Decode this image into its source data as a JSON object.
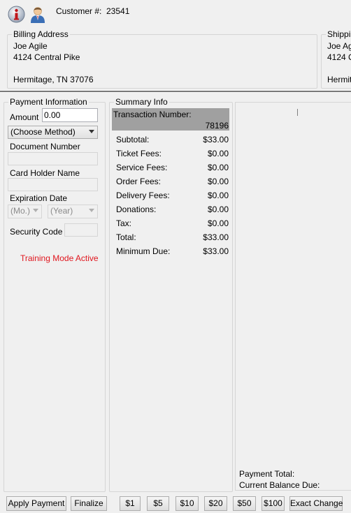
{
  "header": {
    "customer_label": "Customer #:",
    "customer_number": "23541"
  },
  "billing": {
    "legend": "Billing Address",
    "name": "Joe Agile",
    "street": "4124 Central Pike",
    "city_state_zip": "Hermitage, TN 37076"
  },
  "shipping": {
    "legend": "Shippin",
    "name": "Joe Ag",
    "street": "4124 C",
    "city_state_zip": "Hermit"
  },
  "payment": {
    "legend": "Payment Information",
    "amount_label": "Amount",
    "amount_value": "0.00",
    "method_value": "(Choose Method)",
    "document_number_label": "Document Number",
    "card_holder_label": "Card Holder Name",
    "expiration_label": "Expiration Date",
    "month_value": "(Mo.)",
    "year_value": "(Year)",
    "security_code_label": "Security Code",
    "training_mode_text": "Training Mode Active",
    "training_mode_color": "#e0161e"
  },
  "summary": {
    "legend": "Summary Info",
    "transaction_label": "Transaction Number:",
    "transaction_number": "78196",
    "rows": [
      {
        "label": "Subtotal:",
        "value": "$33.00"
      },
      {
        "label": "Ticket Fees:",
        "value": "$0.00"
      },
      {
        "label": "Service Fees:",
        "value": "$0.00"
      },
      {
        "label": "Order Fees:",
        "value": "$0.00"
      },
      {
        "label": "Delivery Fees:",
        "value": "$0.00"
      },
      {
        "label": "Donations:",
        "value": "$0.00"
      },
      {
        "label": "Tax:",
        "value": "$0.00"
      },
      {
        "label": "Total:",
        "value": "$33.00"
      },
      {
        "label": "Minimum Due:",
        "value": "$33.00"
      }
    ]
  },
  "payments_panel": {
    "payment_total_label": "Payment Total:",
    "current_balance_label": "Current Balance Due:"
  },
  "buttons": {
    "apply_payment": "Apply Payment",
    "finalize": "Finalize",
    "one": "$1",
    "five": "$5",
    "ten": "$10",
    "twenty": "$20",
    "fifty": "$50",
    "hundred": "$100",
    "exact_change": "Exact Change"
  },
  "icons": {
    "info": "info-icon",
    "customer": "customer-person-icon"
  },
  "colors": {
    "transaction_header_bg": "#a0a0a0",
    "divider": "#7a7a7a"
  }
}
